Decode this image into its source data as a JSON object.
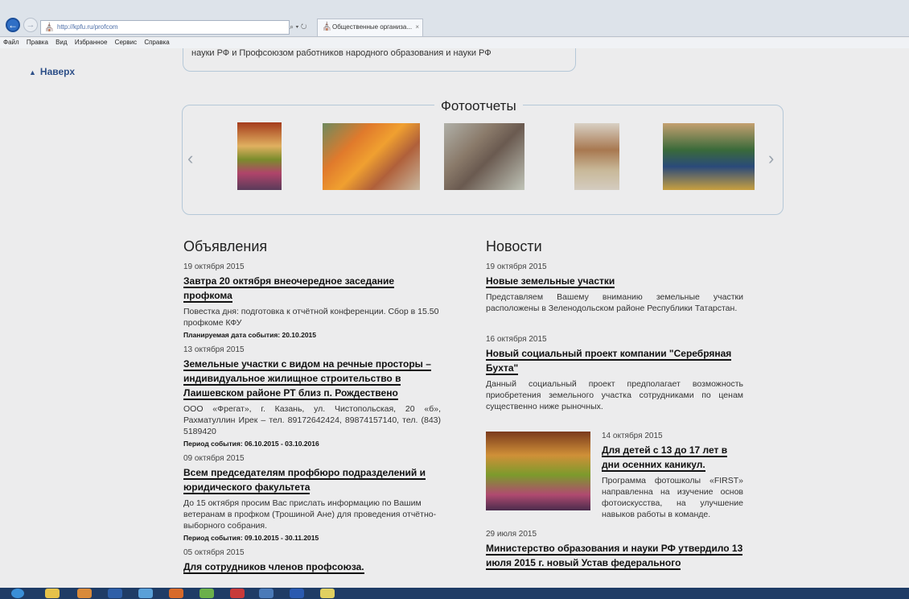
{
  "browser": {
    "address": "http://kpfu.ru/profcom",
    "address_actions": "⌕ ▾ ↻",
    "tab_title": "Общественные организа...",
    "tab_close": "×",
    "back_glyph": "←",
    "forward_glyph": "→",
    "menu": [
      "Файл",
      "Правка",
      "Вид",
      "Избранное",
      "Сервис",
      "Справка"
    ]
  },
  "page": {
    "to_top": "Наверх",
    "prev_box_text": "науки РФ и Профсоюзом работников народного образования и науки РФ",
    "photo_reports": {
      "title": "Фотоотчеты",
      "prev": "‹",
      "next": "›"
    },
    "announcements": {
      "title": "Объявления",
      "items": [
        {
          "date": "19 октября 2015",
          "title": "Завтра 20 октября внеочередное заседание профкома",
          "text": "Повестка дня: подготовка к отчётной конференции. Сбор в 15.50 профкоме КФУ",
          "meta": "Планируемая дата события: 20.10.2015"
        },
        {
          "date": "13 октября 2015",
          "title": "Земельные участки с видом на речные просторы – индивидуальное жилищное строительство в Лаишевском районе РТ близ п. Рождествено",
          "text": "ООО «Фрегат», г. Казань, ул. Чистопольская, 20 «б», Рахматуллин Ирек – тел. 89172642424, 89874157140, тел. (843) 5189420",
          "meta": "Период события: 06.10.2015 - 03.10.2016"
        },
        {
          "date": "09 октября 2015",
          "title": "Всем председателям профбюро подразделений и юридического факультета",
          "text": "До 15 октября просим Вас прислать информацию по Вашим ветеранам в профком (Трошиной Ане) для проведения отчётно-выборного собрания.",
          "meta": "Период события: 09.10.2015 - 30.11.2015"
        },
        {
          "date": "05 октября 2015",
          "title": "Для сотрудников членов профсоюза.",
          "text": "",
          "meta": ""
        }
      ]
    },
    "news": {
      "title": "Новости",
      "items": [
        {
          "date": "19 октября 2015",
          "title": "Новые земельные участки",
          "text": "Представляем Вашему вниманию земельные участки расположены в Зеленодольском районе Республики Татарстан."
        },
        {
          "date": "16 октября 2015",
          "title": "Новый социальный проект компании \"Серебряная Бухта\"",
          "text": "Данный социальный проект предполагает возможность приобретения земельного участка сотрудниками по ценам существенно ниже рыночных."
        },
        {
          "date": "14 октября 2015",
          "title": "Для детей с 13 до 17 лет в дни осенних каникул.",
          "text": "Программа фотошколы «FIRST» направленна на изучение основ фотоискусства, на улучшение навыков работы в команде."
        },
        {
          "date": "29 июля 2015",
          "title": "Министерство образования и науки РФ утвердило 13 июля 2015 г. новый Устав федерального",
          "text": ""
        }
      ]
    }
  }
}
